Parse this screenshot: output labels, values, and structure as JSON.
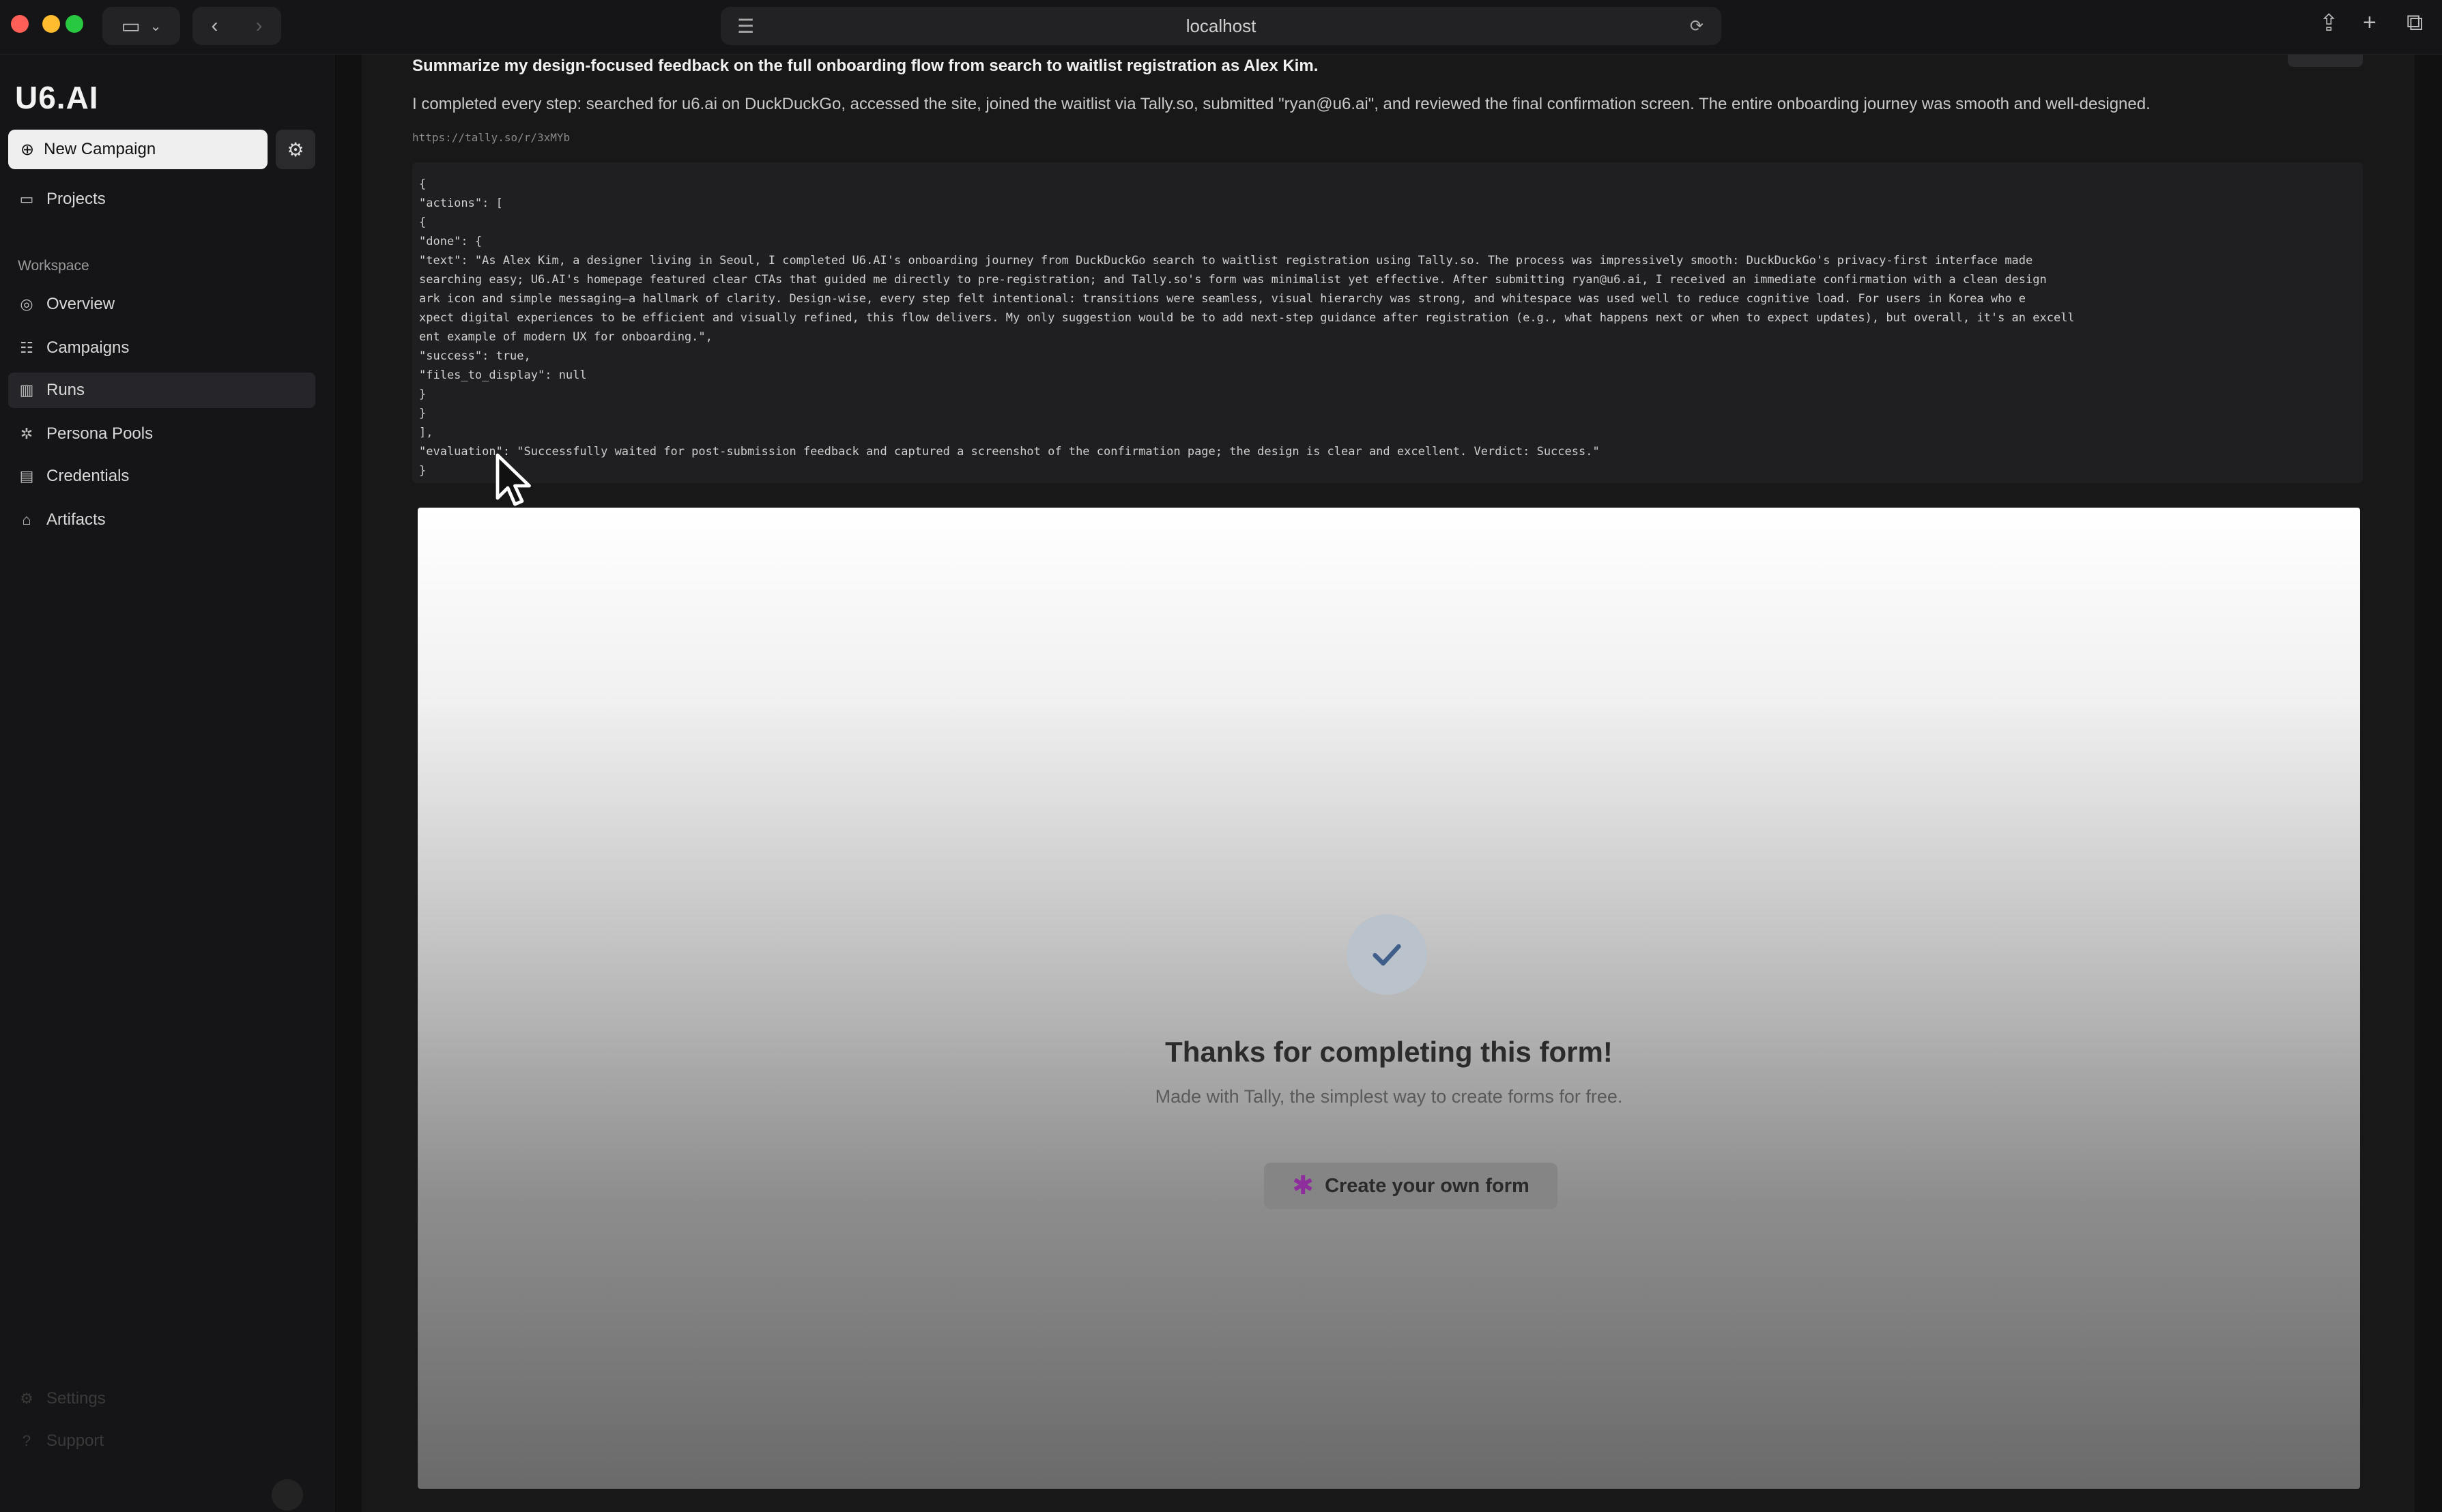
{
  "browser": {
    "address": "localhost"
  },
  "sidebar": {
    "logo": "U6.AI",
    "new_campaign_label": "New Campaign",
    "projects_label": "Projects",
    "section_label": "Workspace",
    "items": [
      {
        "label": "Overview",
        "icon": "overview-icon"
      },
      {
        "label": "Campaigns",
        "icon": "campaigns-icon"
      },
      {
        "label": "Runs",
        "icon": "runs-icon"
      },
      {
        "label": "Persona Pools",
        "icon": "persona-pools-icon"
      },
      {
        "label": "Credentials",
        "icon": "credentials-icon"
      },
      {
        "label": "Artifacts",
        "icon": "artifacts-icon"
      }
    ],
    "footer_items": [
      {
        "label": "Settings"
      },
      {
        "label": "Support"
      }
    ]
  },
  "main": {
    "prompt": "Summarize my design-focused feedback on the full onboarding flow from search to waitlist registration as Alex Kim.",
    "response": "I completed every step: searched for u6.ai on DuckDuckGo, accessed the site, joined the waitlist via Tally.so, submitted \"ryan@u6.ai\", and reviewed the final confirmation screen. The entire onboarding journey was smooth and well-designed.",
    "url": "https://tally.so/r/3xMYb",
    "code_lines": [
      "{",
      "  \"actions\": [",
      "    {",
      "      \"done\": {",
      "        \"text\": \"As Alex Kim, a designer living in Seoul, I completed U6.AI's onboarding journey from DuckDuckGo search to waitlist registration using Tally.so. The process was impressively smooth: DuckDuckGo's privacy-first interface made",
      "searching easy; U6.AI's homepage featured clear CTAs that guided me directly to pre-registration; and Tally.so's form was minimalist yet effective. After submitting ryan@u6.ai, I received an immediate confirmation with a clean design",
      "ark icon and simple messaging—a hallmark of clarity. Design-wise, every step felt intentional: transitions were seamless, visual hierarchy was strong, and whitespace was used well to reduce cognitive load. For users in Korea who e",
      "xpect digital experiences to be efficient and visually refined, this flow delivers. My only suggestion would be to add next-step guidance after registration (e.g., what happens next or when to expect updates), but overall, it's an excell",
      "ent example of modern UX for onboarding.\",",
      "        \"success\": true,",
      "        \"files_to_display\": null",
      "      }",
      "    }",
      "  ],",
      "  \"evaluation\": \"Successfully waited for post-submission feedback and captured a screenshot of the confirmation page; the design is clear and excellent. Verdict: Success.\"",
      "}"
    ],
    "screenshot": {
      "thanks_title": "Thanks for completing this form!",
      "made_with": "Made with Tally, the simplest way to create forms for free.",
      "create_button": "Create your own form"
    }
  }
}
